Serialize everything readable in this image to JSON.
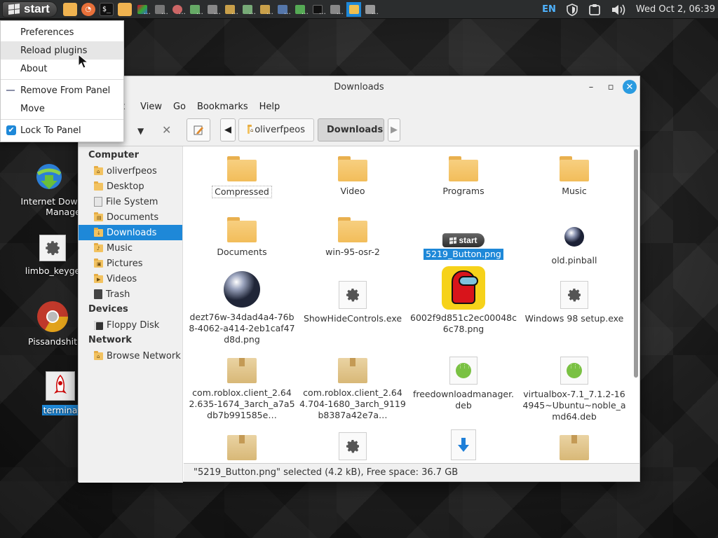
{
  "panel": {
    "start_label": "start",
    "keyboard_layout": "EN",
    "clock": "Wed Oct  2, 06:39"
  },
  "context_menu": {
    "items": [
      {
        "label": "Preferences"
      },
      {
        "label": "Reload plugins"
      },
      {
        "label": "About"
      },
      {
        "label": "Remove From Panel"
      },
      {
        "label": "Move"
      },
      {
        "label": "Lock To Panel"
      }
    ]
  },
  "desktop": {
    "icons": [
      {
        "label": "Internet Dow"
      },
      {
        "label": "Manage"
      },
      {
        "label": "limbo_keyge"
      },
      {
        "label": "Pissandshit"
      },
      {
        "label": "termina"
      }
    ]
  },
  "window": {
    "title": "Downloads",
    "menu": [
      "t",
      "View",
      "Go",
      "Bookmarks",
      "Help"
    ],
    "path": [
      "oliverfpeos",
      "Downloads"
    ],
    "sidebar": {
      "computer_heading": "Computer",
      "computer_items": [
        "oliverfpeos",
        "Desktop",
        "File System",
        "Documents",
        "Downloads",
        "Music",
        "Pictures",
        "Videos",
        "Trash"
      ],
      "devices_heading": "Devices",
      "devices_items": [
        "Floppy Disk"
      ],
      "network_heading": "Network",
      "network_items": [
        "Browse Network"
      ]
    },
    "files": [
      {
        "name": "Compressed",
        "type": "folder"
      },
      {
        "name": "Video",
        "type": "folder"
      },
      {
        "name": "Programs",
        "type": "folder"
      },
      {
        "name": "Music",
        "type": "folder"
      },
      {
        "name": "Documents",
        "type": "folder"
      },
      {
        "name": "win-95-osr-2",
        "type": "folder"
      },
      {
        "name": "5219_Button.png",
        "type": "image",
        "thumb_text": "start"
      },
      {
        "name": "old.pinball",
        "type": "sphere"
      },
      {
        "name": "dezt76w-34dad4a4-76b8-4062-a414-2eb1caf47d8d.png",
        "type": "sphere"
      },
      {
        "name": "ShowHideControls.exe",
        "type": "exe"
      },
      {
        "name": "6002f9d851c2ec00048c6c78.png",
        "type": "amongus"
      },
      {
        "name": "Windows 98 setup.exe",
        "type": "exe"
      },
      {
        "name": "com.roblox.client_2.642.635-1674_3arch_a7a5db7b991585e…",
        "type": "package"
      },
      {
        "name": "com.roblox.client_2.644.704-1680_3arch_9119b8387a42e7a…",
        "type": "package"
      },
      {
        "name": "freedownloadmanager.deb",
        "type": "deb"
      },
      {
        "name": "virtualbox-7.1_7.1.2-164945~Ubuntu~noble_amd64.deb",
        "type": "deb"
      }
    ],
    "status": "\"5219_Button.png\" selected (4.2 kB), Free space: 36.7 GB"
  }
}
